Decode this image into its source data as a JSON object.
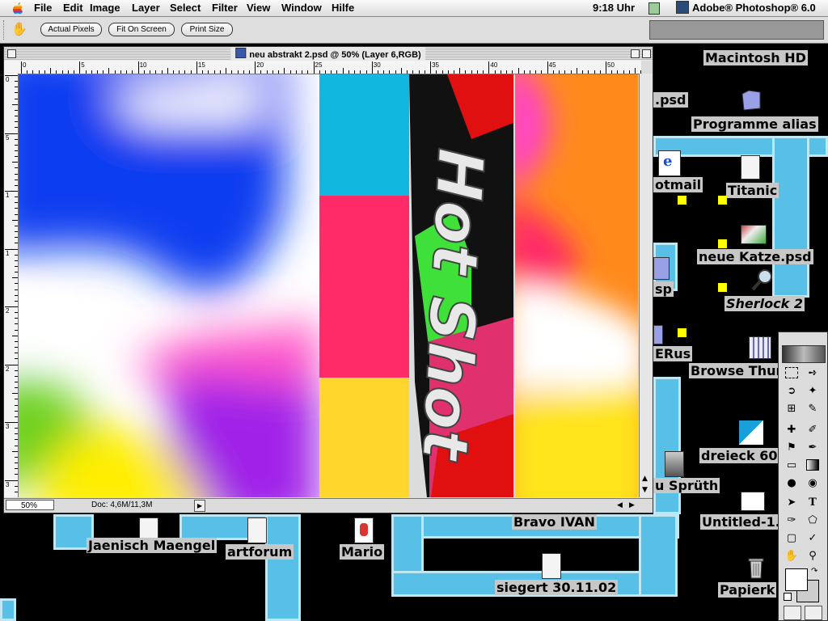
{
  "menubar": {
    "items": [
      "File",
      "Edit",
      "Image",
      "Layer",
      "Select",
      "Filter",
      "View",
      "Window",
      "Hilfe"
    ],
    "clock": "9:18 Uhr",
    "app_name": "Adobe® Photoshop® 6.0"
  },
  "options_bar": {
    "buttons": [
      "Actual Pixels",
      "Fit On Screen",
      "Print Size"
    ]
  },
  "document": {
    "title": "neu abstrakt 2.psd @ 50% (Layer 6,RGB)",
    "zoom": "50%",
    "doc_info": "Doc: 4,6M/11,3M",
    "h_ruler_labels": [
      "0",
      "5",
      "10",
      "15",
      "20",
      "25",
      "30",
      "35",
      "40",
      "45",
      "50"
    ],
    "v_ruler_labels": [
      "0",
      "5",
      "1",
      "1",
      "2",
      "2",
      "3",
      "3"
    ],
    "poster_text": "Hot Shot"
  },
  "desktop": {
    "icons": [
      "Macintosh HD",
      ".psd",
      "Programme alias",
      "otmail",
      "Titanic",
      "neue Katze.psd",
      "sp",
      "Sherlock 2",
      "ERus",
      "Browse Thum",
      "dreieck 60.",
      "u Sprüth",
      "Untitled-1.",
      "Bravo IVAN",
      "Jaenisch Maengel",
      "artforum",
      "Mario",
      "siegert 30.11.02",
      "Papierk"
    ]
  },
  "colors": {
    "desktop_bg": "#000000",
    "pipe": "#58bfe6",
    "label_bg": "#c7c7c7"
  }
}
